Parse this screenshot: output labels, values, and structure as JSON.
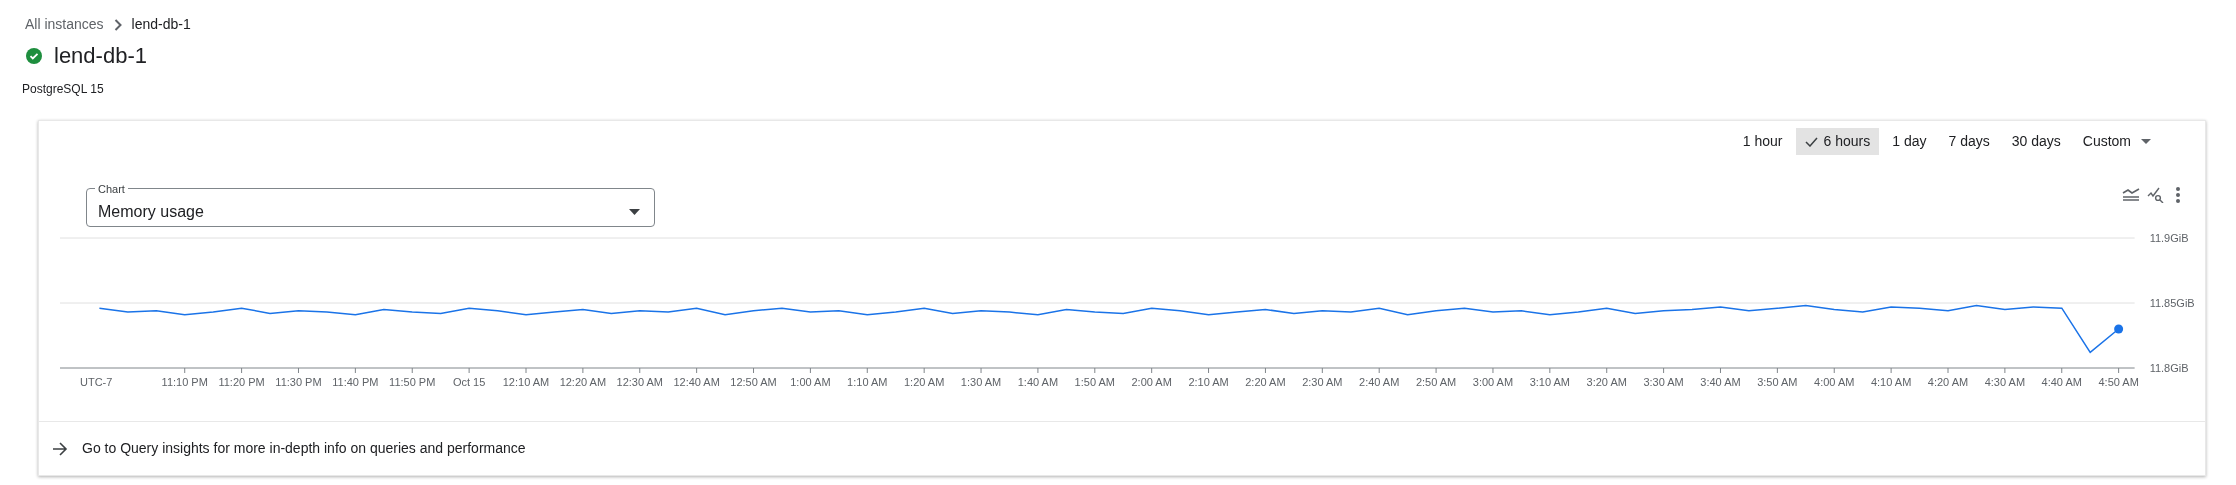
{
  "breadcrumb": [
    {
      "label": "All instances"
    },
    {
      "label": "lend-db-1"
    }
  ],
  "instance": {
    "name": "lend-db-1",
    "healthy": true,
    "version": "PostgreSQL 15"
  },
  "time_ranges": [
    {
      "label": "1 hour",
      "selected": false
    },
    {
      "label": "6 hours",
      "selected": true
    },
    {
      "label": "1 day",
      "selected": false
    },
    {
      "label": "7 days",
      "selected": false
    },
    {
      "label": "30 days",
      "selected": false
    }
  ],
  "custom_range": {
    "label": "Custom"
  },
  "chart_selector": {
    "label": "Chart",
    "value": "Memory usage"
  },
  "chart": {
    "timezone_label": "UTC-7",
    "chart_data": {
      "type": "line",
      "ylim": [
        11.8,
        11.9
      ],
      "yticks": [
        {
          "value": 11.8,
          "label": "11.8GiB"
        },
        {
          "value": 11.85,
          "label": "11.85GiB"
        },
        {
          "value": 11.9,
          "label": "11.9GiB"
        }
      ],
      "categories": [
        null,
        null,
        null,
        "11:10 PM",
        null,
        "11:20 PM",
        null,
        "11:30 PM",
        null,
        "11:40 PM",
        null,
        "11:50 PM",
        null,
        "Oct 15",
        null,
        "12:10 AM",
        null,
        "12:20 AM",
        null,
        "12:30 AM",
        null,
        "12:40 AM",
        null,
        "12:50 AM",
        null,
        "1:00 AM",
        null,
        "1:10 AM",
        null,
        "1:20 AM",
        null,
        "1:30 AM",
        null,
        "1:40 AM",
        null,
        "1:50 AM",
        null,
        "2:00 AM",
        null,
        "2:10 AM",
        null,
        "2:20 AM",
        null,
        "2:30 AM",
        null,
        "2:40 AM",
        null,
        "2:50 AM",
        null,
        "3:00 AM",
        null,
        "3:10 AM",
        null,
        "3:20 AM",
        null,
        "3:30 AM",
        null,
        "3:40 AM",
        null,
        "3:50 AM",
        null,
        "4:00 AM",
        null,
        "4:10 AM",
        null,
        "4:20 AM",
        null,
        "4:30 AM",
        null,
        "4:40 AM",
        null,
        "4:50 AM"
      ],
      "series": [
        {
          "color": "#1a73e8",
          "values": [
            11.846,
            11.843,
            11.844,
            11.841,
            11.843,
            11.846,
            11.842,
            11.844,
            11.843,
            11.841,
            11.845,
            11.843,
            11.842,
            11.846,
            11.844,
            11.841,
            11.843,
            11.845,
            11.842,
            11.844,
            11.843,
            11.846,
            11.841,
            11.844,
            11.846,
            11.843,
            11.844,
            11.841,
            11.843,
            11.846,
            11.842,
            11.844,
            11.843,
            11.841,
            11.845,
            11.843,
            11.842,
            11.846,
            11.844,
            11.841,
            11.843,
            11.845,
            11.842,
            11.844,
            11.843,
            11.846,
            11.841,
            11.844,
            11.846,
            11.843,
            11.844,
            11.841,
            11.843,
            11.846,
            11.842,
            11.844,
            11.845,
            11.847,
            11.844,
            11.846,
            11.848,
            11.845,
            11.843,
            11.847,
            11.846,
            11.844,
            11.848,
            11.845,
            11.847,
            11.846,
            11.812,
            11.83
          ]
        }
      ]
    }
  },
  "footer_link": {
    "label": "Go to Query insights for more in-depth info on queries and performance"
  }
}
